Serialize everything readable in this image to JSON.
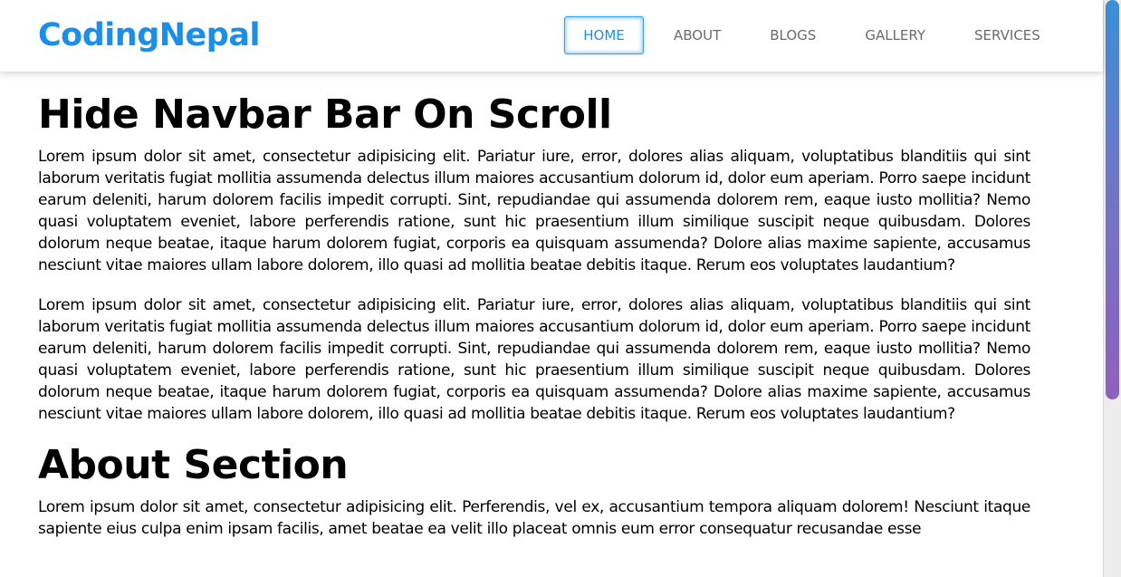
{
  "brand": {
    "logo_text": "CodingNepal",
    "accent_color": "#1a8ee8"
  },
  "nav": {
    "items": [
      {
        "label": "HOME",
        "active": true
      },
      {
        "label": "ABOUT",
        "active": false
      },
      {
        "label": "BLOGS",
        "active": false
      },
      {
        "label": "GALLERY",
        "active": false
      },
      {
        "label": "SERVICES",
        "active": false
      }
    ]
  },
  "main": {
    "section1": {
      "title": "Hide Navbar Bar On Scroll",
      "paragraphs": [
        "Lorem ipsum dolor sit amet, consectetur adipisicing elit. Pariatur iure, error, dolores alias aliquam, voluptatibus blanditiis qui sint laborum veritatis fugiat mollitia assumenda delectus illum maiores accusantium dolorum id, dolor eum aperiam. Porro saepe incidunt earum deleniti, harum dolorem facilis impedit corrupti. Sint, repudiandae qui assumenda dolorem rem, eaque iusto mollitia? Nemo quasi voluptatem eveniet, labore perferendis ratione, sunt hic praesentium illum similique suscipit neque quibusdam. Dolores dolorum neque beatae, itaque harum dolorem fugiat, corporis ea quisquam assumenda? Dolore alias maxime sapiente, accusamus nesciunt vitae maiores ullam labore dolorem, illo quasi ad mollitia beatae debitis itaque. Rerum eos voluptates laudantium?",
        "Lorem ipsum dolor sit amet, consectetur adipisicing elit. Pariatur iure, error, dolores alias aliquam, voluptatibus blanditiis qui sint laborum veritatis fugiat mollitia assumenda delectus illum maiores accusantium dolorum id, dolor eum aperiam. Porro saepe incidunt earum deleniti, harum dolorem facilis impedit corrupti. Sint, repudiandae qui assumenda dolorem rem, eaque iusto mollitia? Nemo quasi voluptatem eveniet, labore perferendis ratione, sunt hic praesentium illum similique suscipit neque quibusdam. Dolores dolorum neque beatae, itaque harum dolorem fugiat, corporis ea quisquam assumenda? Dolore alias maxime sapiente, accusamus nesciunt vitae maiores ullam labore dolorem, illo quasi ad mollitia beatae debitis itaque. Rerum eos voluptates laudantium?"
      ]
    },
    "section2": {
      "title": "About Section",
      "paragraphs": [
        "Lorem ipsum dolor sit amet, consectetur adipisicing elit. Perferendis, vel ex, accusantium tempora aliquam dolorem! Nesciunt itaque sapiente eius culpa enim ipsam facilis, amet beatae ea velit illo placeat omnis eum error consequatur recusandae esse"
      ]
    }
  },
  "scrollbar": {
    "thumb_colors": [
      "#3a90d9",
      "#8f5fbf"
    ]
  }
}
